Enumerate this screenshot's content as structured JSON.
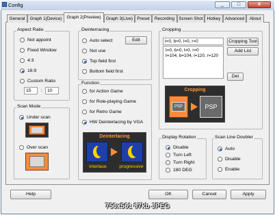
{
  "window": {
    "title": "Config",
    "minimize": "_",
    "maximize": "□",
    "close": "X"
  },
  "tabs": [
    {
      "label": "General"
    },
    {
      "label": "Graph 1(Device)"
    },
    {
      "label": "Graph 2(Preview)"
    },
    {
      "label": "Graph 3(Live)"
    },
    {
      "label": "Preset"
    },
    {
      "label": "Recording"
    },
    {
      "label": "Screen Shot"
    },
    {
      "label": "Hotkey"
    },
    {
      "label": "Advanced"
    },
    {
      "label": "About"
    }
  ],
  "aspect_ratio": {
    "label": "Aspect Ratio",
    "options": [
      "Not appoint",
      "Fixed Window",
      "4:3",
      "16:9",
      "Custom Ratio"
    ],
    "selected": "16:9",
    "custom_w": "15",
    "custom_sep": ":",
    "custom_h": "10"
  },
  "scan_mode": {
    "label": "Scan Mode",
    "options": [
      "Under scan",
      "Over scan"
    ],
    "selected": "Under scan"
  },
  "deinterlacing": {
    "label": "Deinterracing",
    "options": [
      "Auto select",
      "Not use",
      "Top field first",
      "Bottom field first"
    ],
    "selected": "Top field first",
    "edit_button": "Edit"
  },
  "function": {
    "label": "Function",
    "options": [
      "for Action Game",
      "for Role-playing Game",
      "for Retro Game",
      "HW Deinterlacing by VGA"
    ],
    "selected": "HW Deinterlacing by VGA"
  },
  "deint_image": {
    "title": "Deinterlacing",
    "left": "interlace",
    "right": "progressive"
  },
  "cropping": {
    "label": "Cropping",
    "input_value": "t=0, b=0, l=0, r=0",
    "list_items": [
      "t=0, b=0, l=0, r=0",
      "t=104, b=104, l=120, r=120"
    ],
    "tool_button": "Cropping Tool",
    "add_button": "Add List",
    "del_button": "Del",
    "image_title": "Cropping",
    "image_left": "PSP",
    "image_right": "PSP"
  },
  "display_rotation": {
    "label": "Display Rotation",
    "options": [
      "Disable",
      "Turn Left",
      "Turn Right",
      "180 DEG"
    ],
    "selected": "Disable"
  },
  "scan_line": {
    "label": "Scan Line Doubler",
    "options": [
      "Auto",
      "Disable",
      "Enable"
    ],
    "selected": "Auto"
  },
  "footer": {
    "help": "Help",
    "ok": "OK",
    "cancel": "Cancel",
    "apply": "Apply"
  },
  "watermark": "756x561  87kb  JPEG",
  "colors": {
    "accent": "#1a5bb8",
    "orange": "#ff8a3c",
    "dark_panel": "#2d2d2d",
    "blue_panel": "#1f3fa8"
  }
}
